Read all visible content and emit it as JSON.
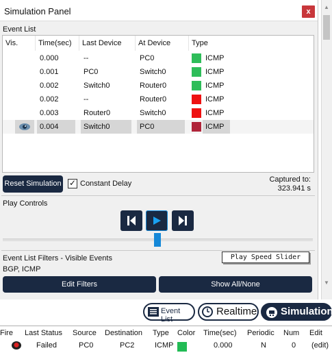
{
  "window": {
    "title": "Simulation Panel",
    "close_label": "x"
  },
  "event_list": {
    "label": "Event List",
    "columns": [
      "Vis.",
      "Time(sec)",
      "Last Device",
      "At Device",
      "Type"
    ],
    "rows": [
      {
        "vis": "",
        "time": "0.000",
        "last": "--",
        "at": "PC0",
        "type": "ICMP",
        "color": "#2ebd59"
      },
      {
        "vis": "",
        "time": "0.001",
        "last": "PC0",
        "at": "Switch0",
        "type": "ICMP",
        "color": "#2ebd59"
      },
      {
        "vis": "",
        "time": "0.002",
        "last": "Switch0",
        "at": "Router0",
        "type": "ICMP",
        "color": "#2ebd59"
      },
      {
        "vis": "",
        "time": "0.002",
        "last": "--",
        "at": "Router0",
        "type": "ICMP",
        "color": "#ee1111"
      },
      {
        "vis": "",
        "time": "0.003",
        "last": "Router0",
        "at": "Switch0",
        "type": "ICMP",
        "color": "#ee1111"
      },
      {
        "vis": "eye-icon",
        "time": "0.004",
        "last": "Switch0",
        "at": "PC0",
        "type": "ICMP",
        "color": "#b0253a"
      }
    ],
    "reset_label": "Reset Simulation",
    "constant_delay_label": "Constant Delay",
    "constant_delay_checked": true,
    "captured_label": "Captured to:",
    "captured_value": "323.941 s"
  },
  "play_controls": {
    "label": "Play Controls",
    "buttons": [
      "back-icon",
      "play-icon",
      "forward-icon"
    ],
    "tooltip": "Play Speed Slider"
  },
  "filters": {
    "label": "Event List Filters - Visible Events",
    "value": "BGP, ICMP",
    "edit_label": "Edit Filters",
    "show_all_label": "Show All/None"
  },
  "bottom_tabs": {
    "event_list": "Event List",
    "realtime": "Realtime",
    "simulation": "Simulation"
  },
  "pdu_table": {
    "columns": [
      "Fire",
      "Last Status",
      "Source",
      "Destination",
      "Type",
      "Color",
      "Time(sec)",
      "Periodic",
      "Num",
      "Edit"
    ],
    "row": {
      "status": "Failed",
      "source": "PC0",
      "destination": "PC2",
      "type": "ICMP",
      "color": "#22bb55",
      "time": "0.000",
      "periodic": "N",
      "num": "0",
      "edit": "(edit)"
    }
  },
  "colors": {
    "accent": "#1a2942",
    "play_button_active": "#1588d8"
  }
}
